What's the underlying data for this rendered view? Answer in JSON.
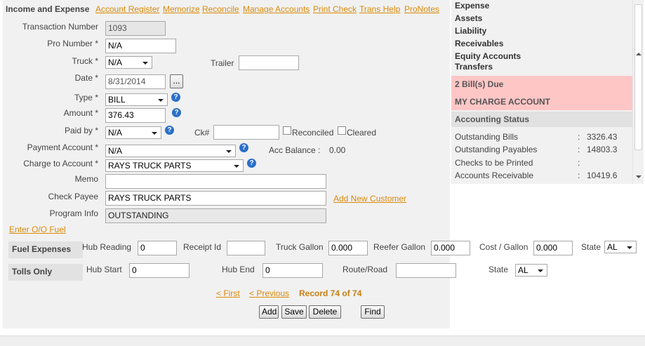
{
  "header": {
    "title": "Income and Expense",
    "links": [
      "Account Register",
      "Memorize",
      "Reconcile",
      "Manage Accounts",
      "Print Check",
      "Trans Help",
      "ProNotes"
    ]
  },
  "form": {
    "transaction_number": {
      "label": "Transaction Number",
      "value": "1093"
    },
    "pro_number": {
      "label": "Pro Number *",
      "value": "N/A"
    },
    "truck": {
      "label": "Truck *",
      "value": "N/A"
    },
    "trailer": {
      "label": "Trailer",
      "value": ""
    },
    "date": {
      "label": "Date *",
      "value": "8/31/2014",
      "button": "..."
    },
    "type": {
      "label": "Type *",
      "value": "BILL"
    },
    "amount": {
      "label": "Amount *",
      "value": "376.43"
    },
    "paid_by": {
      "label": "Paid by *",
      "value": "N/A"
    },
    "check_number": {
      "label": "Ck#",
      "value": ""
    },
    "reconciled": {
      "label": "Reconciled",
      "checked": false
    },
    "cleared": {
      "label": "Cleared",
      "checked": false
    },
    "payment_account": {
      "label": "Payment Account *",
      "value": "N/A"
    },
    "acc_balance": {
      "label": "Acc Balance :",
      "value": "0.00"
    },
    "charge_to_account": {
      "label": "Charge to Account *",
      "value": "RAYS TRUCK PARTS"
    },
    "memo": {
      "label": "Memo",
      "value": ""
    },
    "check_payee": {
      "label": "Check Payee",
      "value": "RAYS TRUCK PARTS"
    },
    "add_new_customer": "Add New Customer",
    "program_info": {
      "label": "Program Info",
      "value": "OUTSTANDING"
    },
    "help_glyph": "?"
  },
  "enter_oo_fuel": "Enter O/O Fuel",
  "fuel_expenses": {
    "label": "Fuel Expenses",
    "hub_reading": {
      "label": "Hub Reading",
      "value": "0"
    },
    "receipt_id": {
      "label": "Receipt Id",
      "value": ""
    },
    "truck_gallon": {
      "label": "Truck Gallon",
      "value": "0.000"
    },
    "reefer_gallon": {
      "label": "Reefer Gallon",
      "value": "0.000"
    },
    "cost_per_gallon": {
      "label": "Cost / Gallon",
      "value": "0.000"
    },
    "state": {
      "label": "State",
      "value": "AL"
    }
  },
  "tolls_only": {
    "label": "Tolls Only",
    "hub_start": {
      "label": "Hub Start",
      "value": "0"
    },
    "hub_end": {
      "label": "Hub End",
      "value": "0"
    },
    "route_road": {
      "label": "Route/Road",
      "value": ""
    },
    "state": {
      "label": "State",
      "value": "AL"
    }
  },
  "pager": {
    "first": "< First",
    "previous": "< Previous",
    "record": "Record 74 of 74"
  },
  "buttons": {
    "add": "Add",
    "save": "Save",
    "delete": "Delete",
    "find": "Find"
  },
  "right_panel": {
    "categories": [
      "Expense",
      "Assets",
      "Liability",
      "Receivables",
      "Equity Accounts",
      "Transfers"
    ],
    "bills_due": "2 Bill(s) Due",
    "charge_account": "MY CHARGE ACCOUNT",
    "accounting_status": {
      "title": "Accounting Status",
      "separator": ":",
      "rows": [
        {
          "name": "Outstanding Bills",
          "value": "3326.43"
        },
        {
          "name": "Outstanding Payables",
          "value": "14803.3"
        },
        {
          "name": "Checks to be Printed",
          "value": ""
        },
        {
          "name": "Accounts Receivable",
          "value": "10419.6"
        }
      ]
    }
  },
  "colors": {
    "link": "#d98a0c",
    "panel_bg": "#f1f1f1",
    "due_bg": "#ffc6c6",
    "help_icon": "#2a6fc9",
    "record_text": "#c87e12"
  }
}
